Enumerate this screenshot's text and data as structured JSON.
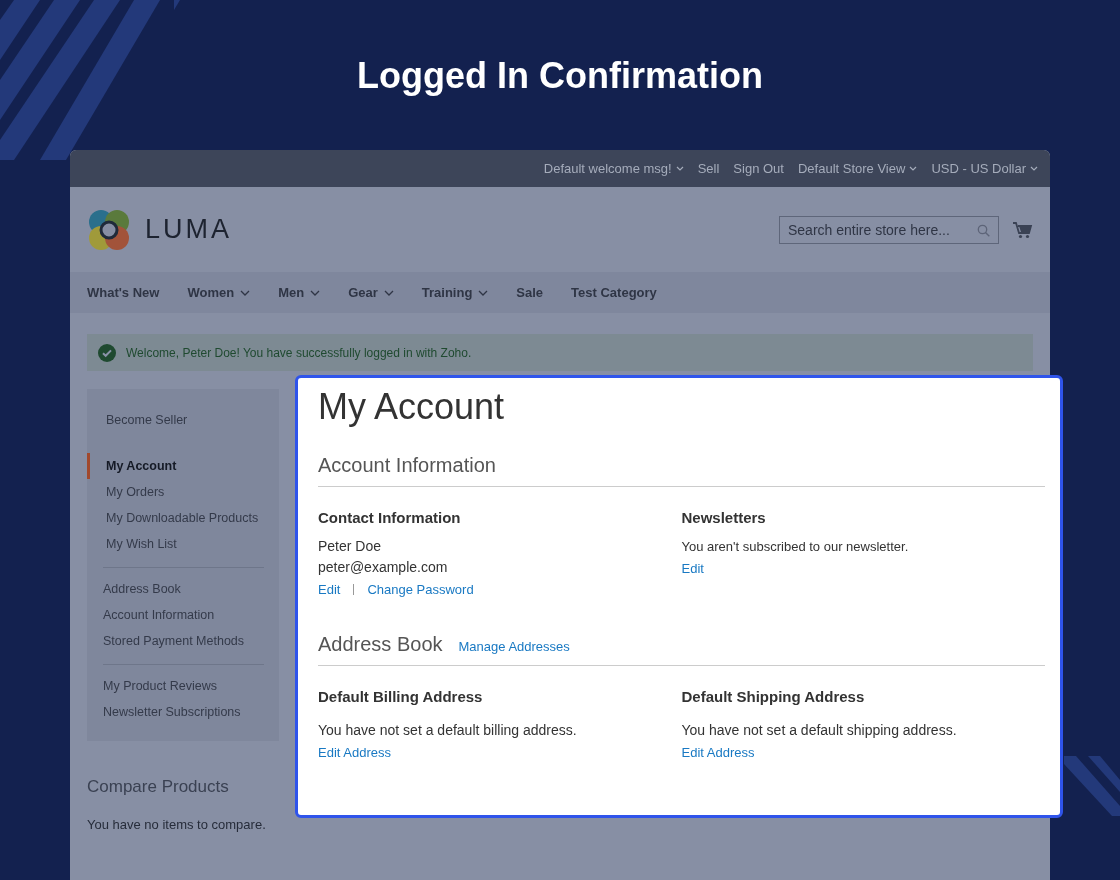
{
  "heading": "Logged In Confirmation",
  "top_links": [
    {
      "label": "Default welcome msg!",
      "dropdown": true
    },
    {
      "label": "Sell",
      "dropdown": false
    },
    {
      "label": "Sign Out",
      "dropdown": false
    },
    {
      "label": "Default Store View",
      "dropdown": true
    },
    {
      "label": "USD - US Dollar",
      "dropdown": true
    }
  ],
  "logo": "LUMA",
  "search": {
    "placeholder": "Search entire store here..."
  },
  "nav": [
    {
      "label": "What's New",
      "dropdown": false
    },
    {
      "label": "Women",
      "dropdown": true
    },
    {
      "label": "Men",
      "dropdown": true
    },
    {
      "label": "Gear",
      "dropdown": true
    },
    {
      "label": "Training",
      "dropdown": true
    },
    {
      "label": "Sale",
      "dropdown": false
    },
    {
      "label": "Test Category",
      "dropdown": false
    }
  ],
  "message": "Welcome, Peter Doe! You have successfully logged in with Zoho.",
  "sidebar": {
    "sections": [
      {
        "divider_before": false,
        "items": [
          {
            "label": "Become Seller",
            "selected": false
          }
        ]
      },
      {
        "divider_before": false,
        "items": [
          {
            "label": "My Account",
            "selected": true
          },
          {
            "label": "My Orders",
            "selected": false
          },
          {
            "label": "My Downloadable Products",
            "selected": false
          },
          {
            "label": "My Wish List",
            "selected": false
          }
        ]
      },
      {
        "divider_before": true,
        "items": [
          {
            "label": "Address Book",
            "selected": false
          },
          {
            "label": "Account Information",
            "selected": false
          },
          {
            "label": "Stored Payment Methods",
            "selected": false
          }
        ]
      },
      {
        "divider_before": true,
        "items": [
          {
            "label": "My Product Reviews",
            "selected": false
          },
          {
            "label": "Newsletter Subscriptions",
            "selected": false
          }
        ]
      }
    ]
  },
  "compare": {
    "title": "Compare Products",
    "text": "You have no items to compare."
  },
  "account": {
    "title": "My Account",
    "info_title": "Account Information",
    "contact": {
      "title": "Contact Information",
      "name": "Peter Doe",
      "email": "peter@example.com",
      "links": [
        "Edit",
        "Change Password"
      ]
    },
    "newsletters": {
      "title": "Newsletters",
      "text": "You aren't subscribed to our newsletter.",
      "link": "Edit"
    },
    "address_title": "Address Book",
    "address_link": "Manage Addresses",
    "billing": {
      "title": "Default Billing Address",
      "text": "You have not set a default billing address.",
      "link": "Edit Address"
    },
    "shipping": {
      "title": "Default Shipping Address",
      "text": "You have not set a default shipping address.",
      "link": "Edit Address"
    }
  }
}
